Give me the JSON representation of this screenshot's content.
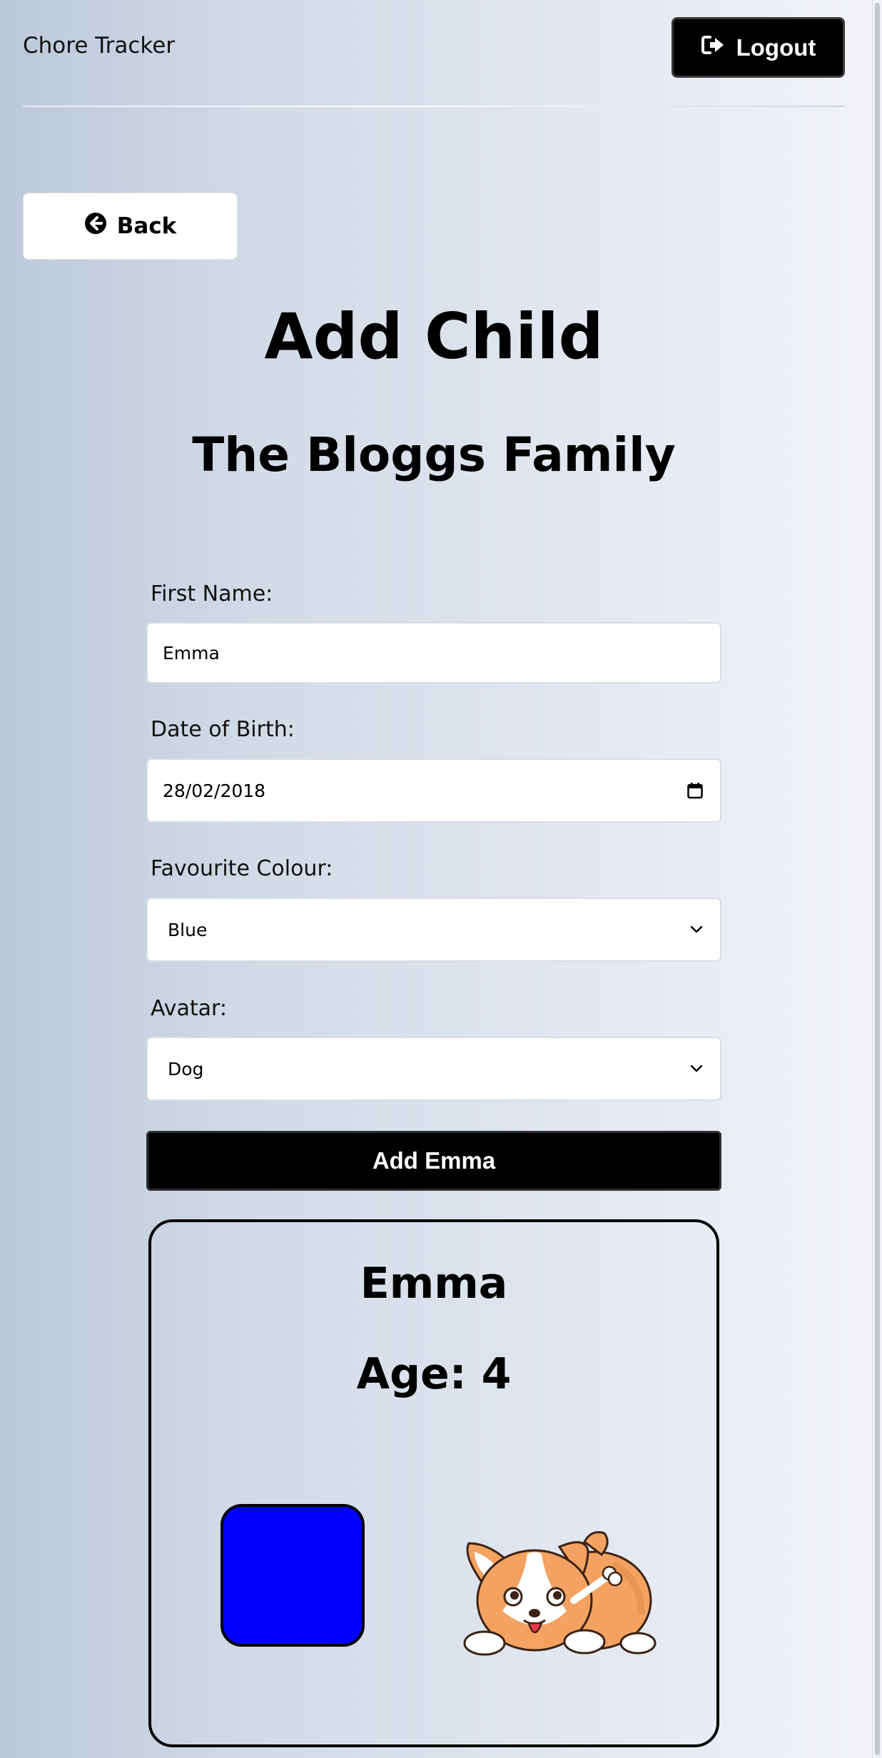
{
  "header": {
    "brand": "Chore Tracker",
    "logout_label": "Logout",
    "logout_icon": "sign-out-icon"
  },
  "nav": {
    "back_label": "Back",
    "back_icon": "arrow-circle-left-icon"
  },
  "page": {
    "title": "Add Child",
    "family": "The Bloggs Family"
  },
  "form": {
    "first_name": {
      "label": "First Name:",
      "value": "Emma"
    },
    "dob": {
      "label": "Date of Birth:",
      "value": "28/02/2018",
      "icon": "calendar-icon"
    },
    "colour": {
      "label": "Favourite Colour:",
      "value": "Blue",
      "icon": "chevron-down-icon"
    },
    "avatar": {
      "label": "Avatar:",
      "value": "Dog",
      "icon": "chevron-down-icon"
    },
    "submit_label": "Add Emma"
  },
  "preview": {
    "name": "Emma",
    "age": "Age: 4",
    "swatch_color": "#0000ff",
    "avatar_icon": "corgi-dog-icon"
  }
}
